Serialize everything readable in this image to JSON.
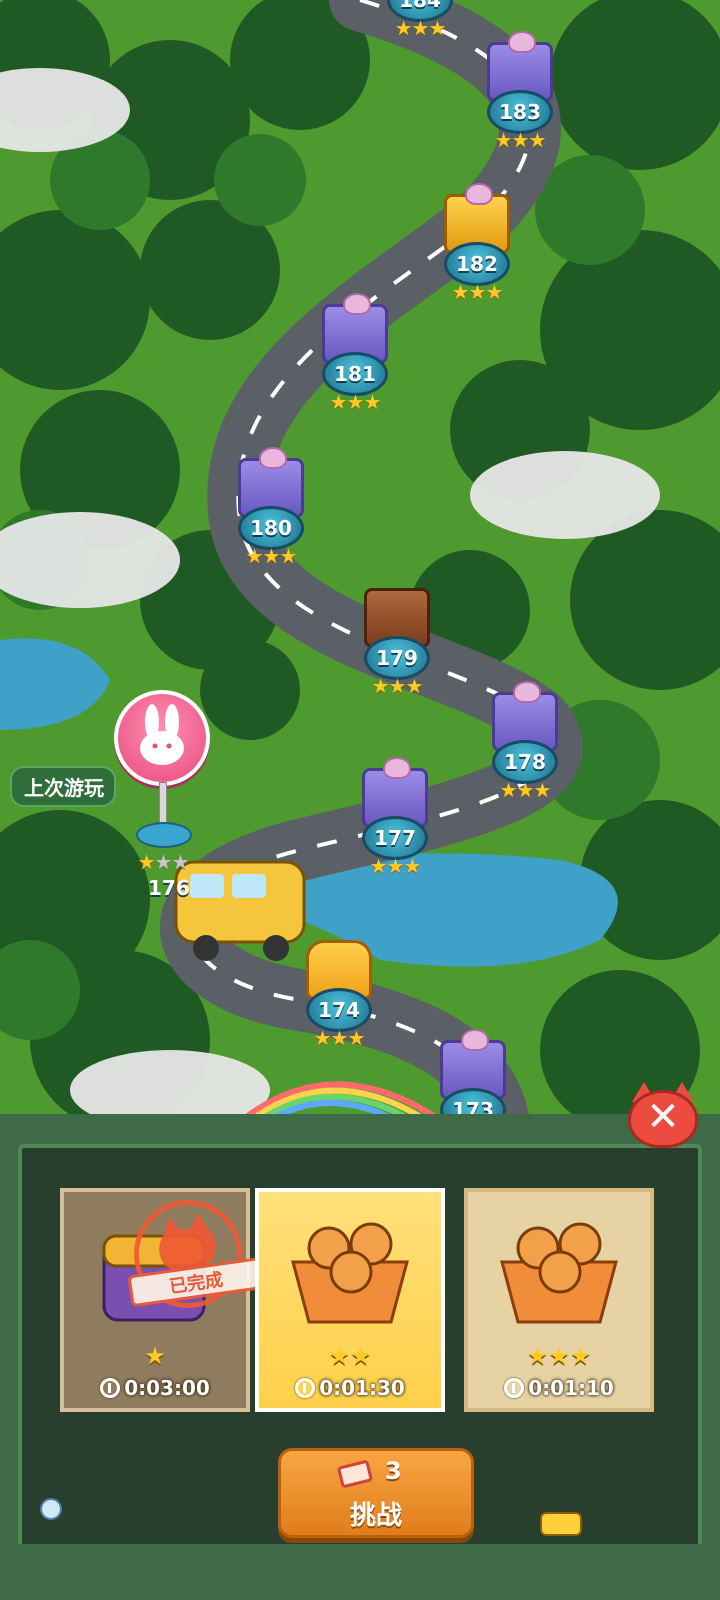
{
  "map": {
    "levels": [
      {
        "number": "184",
        "stars": 3,
        "chest": "purple"
      },
      {
        "number": "183",
        "stars": 3,
        "chest": "purple"
      },
      {
        "number": "182",
        "stars": 3,
        "chest": "gold"
      },
      {
        "number": "181",
        "stars": 3,
        "chest": "purple"
      },
      {
        "number": "180",
        "stars": 3,
        "chest": "purple"
      },
      {
        "number": "179",
        "stars": 3,
        "chest": "wood"
      },
      {
        "number": "178",
        "stars": 3,
        "chest": "purple"
      },
      {
        "number": "177",
        "stars": 3,
        "chest": "purple"
      },
      {
        "number": "176",
        "stars": 1,
        "chest": "purple"
      },
      {
        "number": "174",
        "stars": 3,
        "chest": "cat"
      },
      {
        "number": "173",
        "stars": 0,
        "chest": "purple"
      }
    ],
    "last_played_label": "上次游玩",
    "pin_icon": "rabbit-icon"
  },
  "panel": {
    "cards": [
      {
        "stars": 1,
        "time": "0:03:00",
        "state": "completed",
        "stamp_text": "已完成",
        "art": "cat-treasure-chest"
      },
      {
        "stars": 2,
        "time": "0:01:30",
        "state": "selected",
        "art": "squirrel-basket"
      },
      {
        "stars": 3,
        "time": "0:01:10",
        "state": "normal",
        "art": "squirrel-basket"
      }
    ],
    "challenge": {
      "ticket_count": "3",
      "label": "挑战"
    },
    "close_icon": "close-icon"
  },
  "colors": {
    "accent_orange": "#e88a24",
    "star_gold": "#ffc928",
    "stamp_red": "#ef5a33"
  }
}
